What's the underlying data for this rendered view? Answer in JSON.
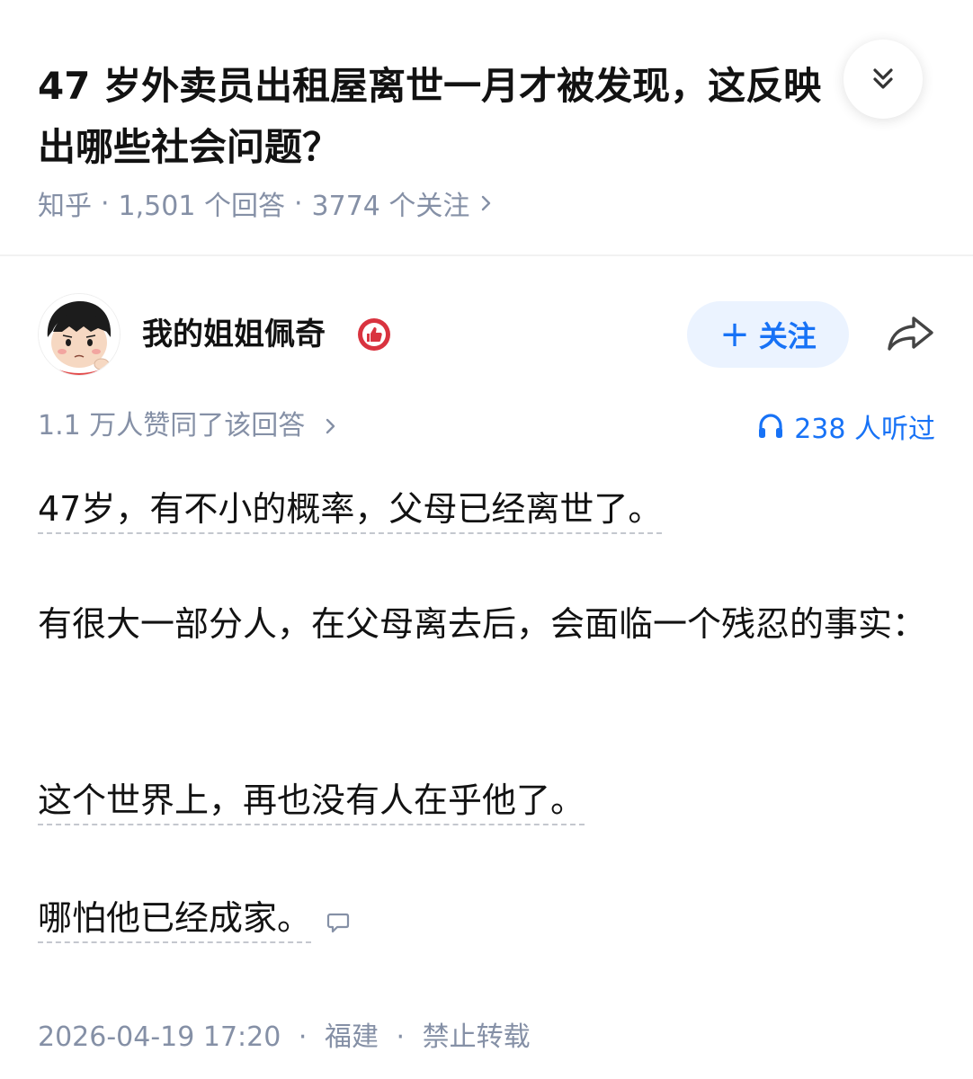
{
  "question": {
    "title": "47 岁外卖员出租屋离世一月才被发现，这反映出哪些社会问题？",
    "source": "知乎",
    "answer_count": "1,501 个回答",
    "follow_count": "3774 个关注",
    "meta_separator": "·",
    "collapse_icon": "double-chevron-down-icon"
  },
  "author": {
    "name": "我的姐姐佩奇",
    "badge_icon": "thumbs-up-badge-icon",
    "follow_label": "关注",
    "follow_plus": "+",
    "share_icon": "share-arrow-icon"
  },
  "stats": {
    "upvotes": "1.1 万人赞同了该回答",
    "listens": "238 人听过"
  },
  "content": {
    "p1": "47岁，有不小的概率，父母已经离世了。",
    "p2": "有很大一部分人，在父母离去后，会面临一个残忍的事实：",
    "p3": "这个世界上，再也没有人在乎他了。",
    "p4": "哪怕他已经成家。"
  },
  "footer": {
    "date": "2026-04-19 17:20",
    "location": "福建",
    "copyright": "禁止转载"
  },
  "colors": {
    "primary": "#1772f6",
    "follow_bg": "#ebf3ff",
    "meta": "#8590a6",
    "text": "#121212",
    "badge": "#d9333f"
  }
}
